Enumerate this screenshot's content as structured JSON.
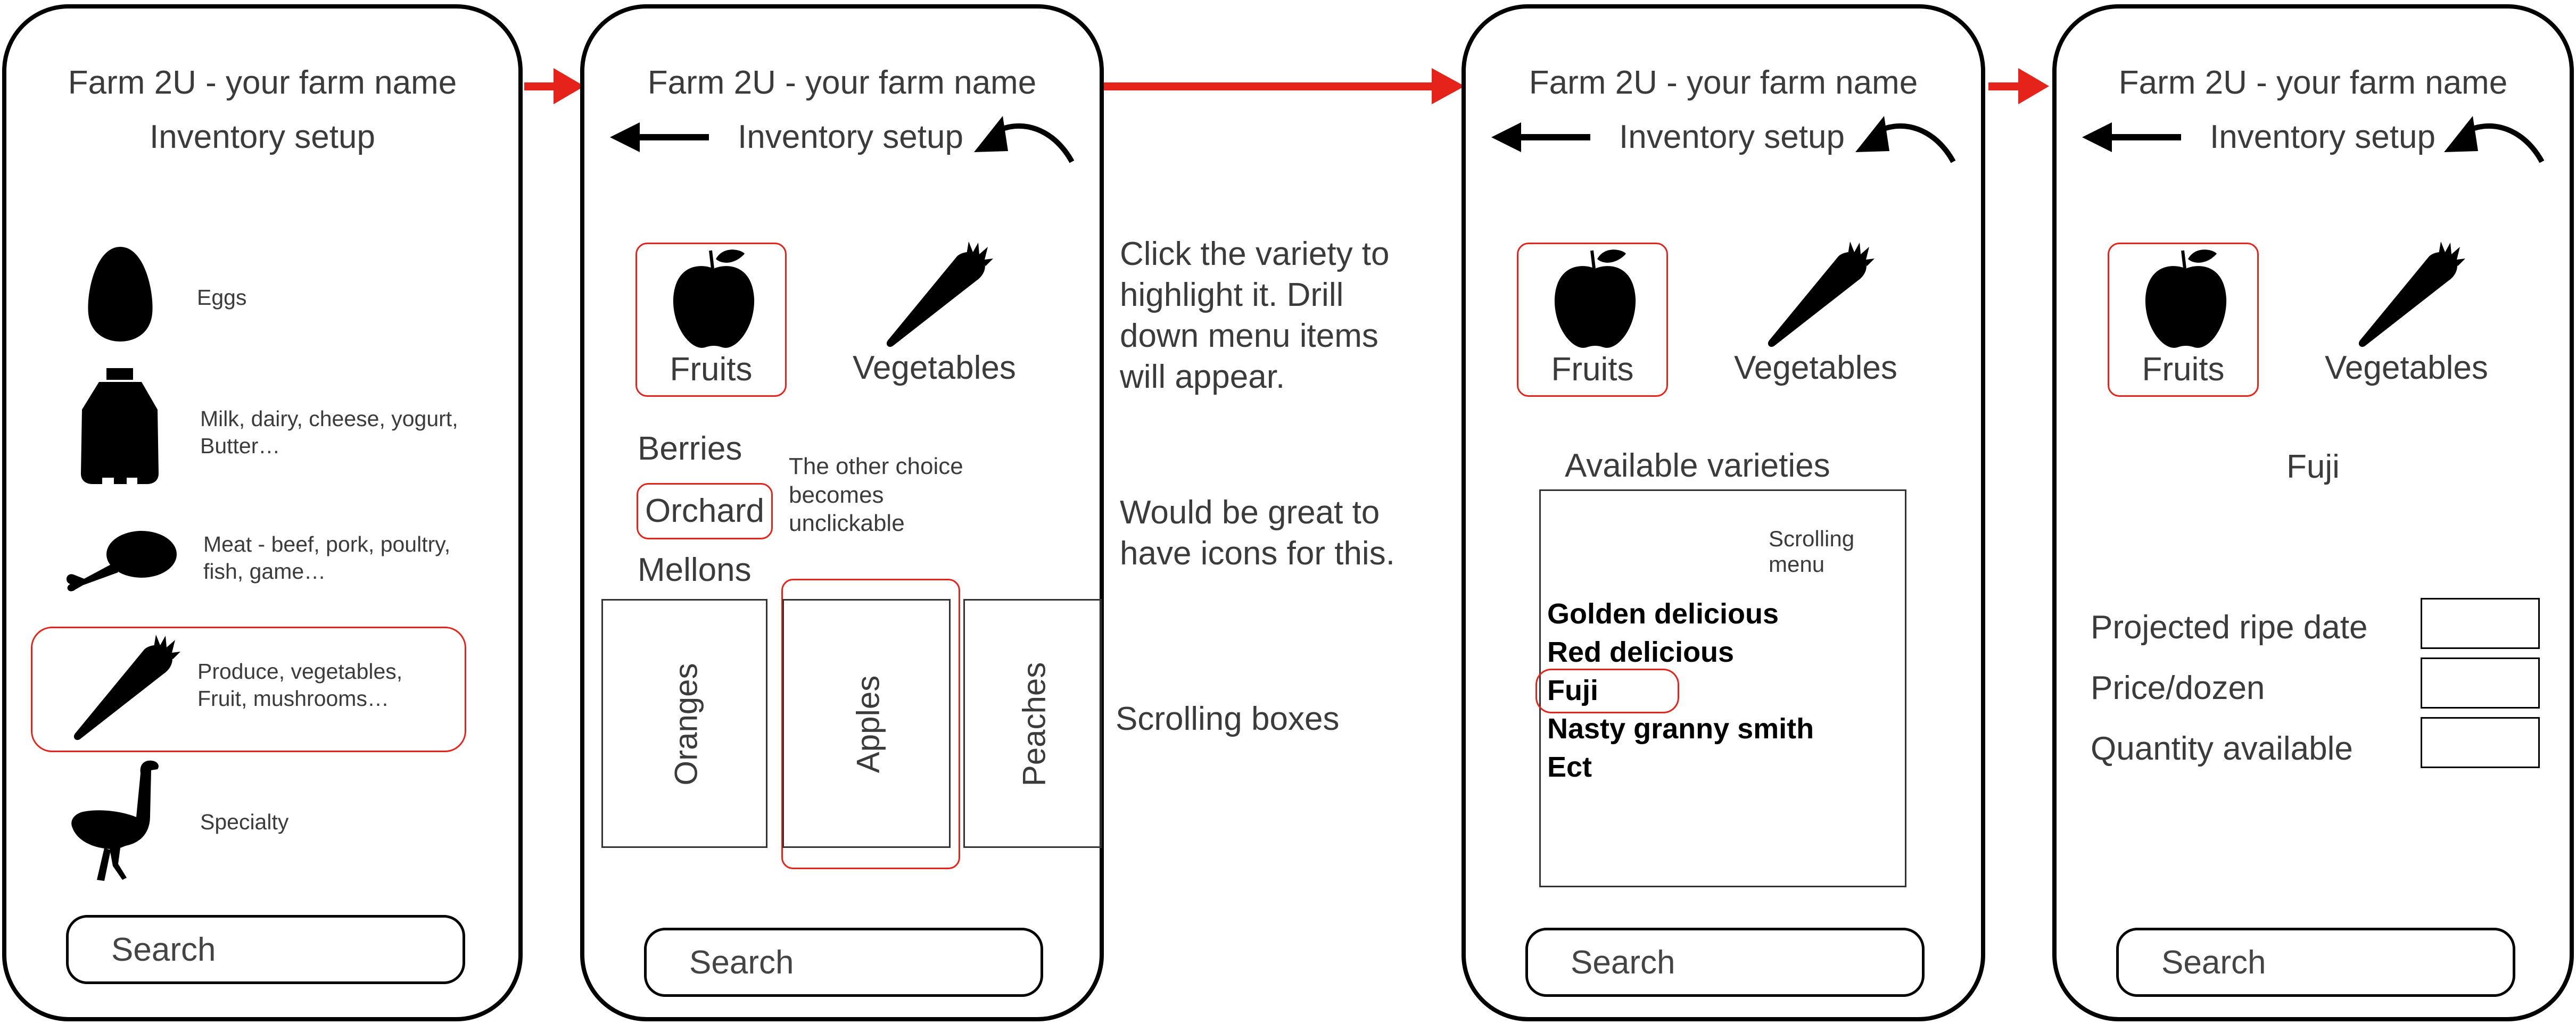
{
  "app_title": "Farm 2U - your farm name",
  "screen_title": "Inventory setup",
  "search_placeholder": "Search",
  "screen1": {
    "categories": [
      {
        "icon": "egg-icon",
        "label": "Eggs"
      },
      {
        "icon": "milk-jug-icon",
        "label": "Milk, dairy, cheese, yogurt, Butter…"
      },
      {
        "icon": "drumstick-icon",
        "label": "Meat - beef, pork, poultry, fish, game…"
      },
      {
        "icon": "carrot-icon",
        "label": "Produce, vegetables, Fruit, mushrooms…"
      },
      {
        "icon": "ostrich-icon",
        "label": "Specialty"
      }
    ]
  },
  "screen2": {
    "fruits_label": "Fruits",
    "vegetables_label": "Vegetables",
    "menu": [
      "Berries",
      "Orchard",
      "Mellons"
    ],
    "note": "The other choice becomes unclickable",
    "boxes": [
      "Oranges",
      "Apples",
      "Peaches"
    ]
  },
  "annotations": {
    "click_variety": "Click the variety to highlight it. Drill down menu items will appear.",
    "icons_note": "Would be great to have icons for this.",
    "scrolling_boxes": "Scrolling boxes"
  },
  "screen3": {
    "fruits_label": "Fruits",
    "vegetables_label": "Vegetables",
    "available_title": "Available varieties",
    "scrolling_menu_label": "Scrolling menu",
    "varieties": [
      "Golden delicious",
      "Red delicious",
      "Fuji",
      "Nasty granny smith",
      "Ect"
    ]
  },
  "screen4": {
    "fruits_label": "Fruits",
    "vegetables_label": "Vegetables",
    "selected_variety": "Fuji",
    "fields": [
      "Projected ripe date",
      "Price/dozen",
      "Quantity available"
    ]
  },
  "colors": {
    "accent": "#e5231b",
    "ink": "#000000",
    "text": "#3b3b3b"
  }
}
